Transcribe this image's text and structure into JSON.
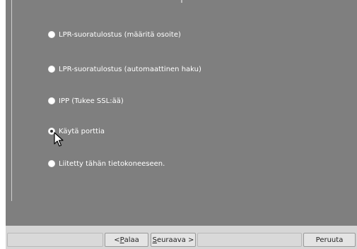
{
  "options": [
    {
      "label": "LPR-suoratulostus (määritä osoite)",
      "selected": false
    },
    {
      "label": "LPR-suoratulostus (automaattinen haku)",
      "selected": false
    },
    {
      "label": "IPP (Tukee SSL:ää)",
      "selected": false
    },
    {
      "label": "Käytä porttia",
      "selected": true
    },
    {
      "label": "Liitetty tähän tietokoneeseen.",
      "selected": false
    }
  ],
  "buttons": {
    "back_prefix": "< ",
    "back_mnemonic": "P",
    "back_rest": "alaa",
    "next_mnemonic": "S",
    "next_rest": "euraava >",
    "cancel_label": "Peruuta"
  },
  "icons": {
    "cursor": "arrow-cursor-icon"
  }
}
